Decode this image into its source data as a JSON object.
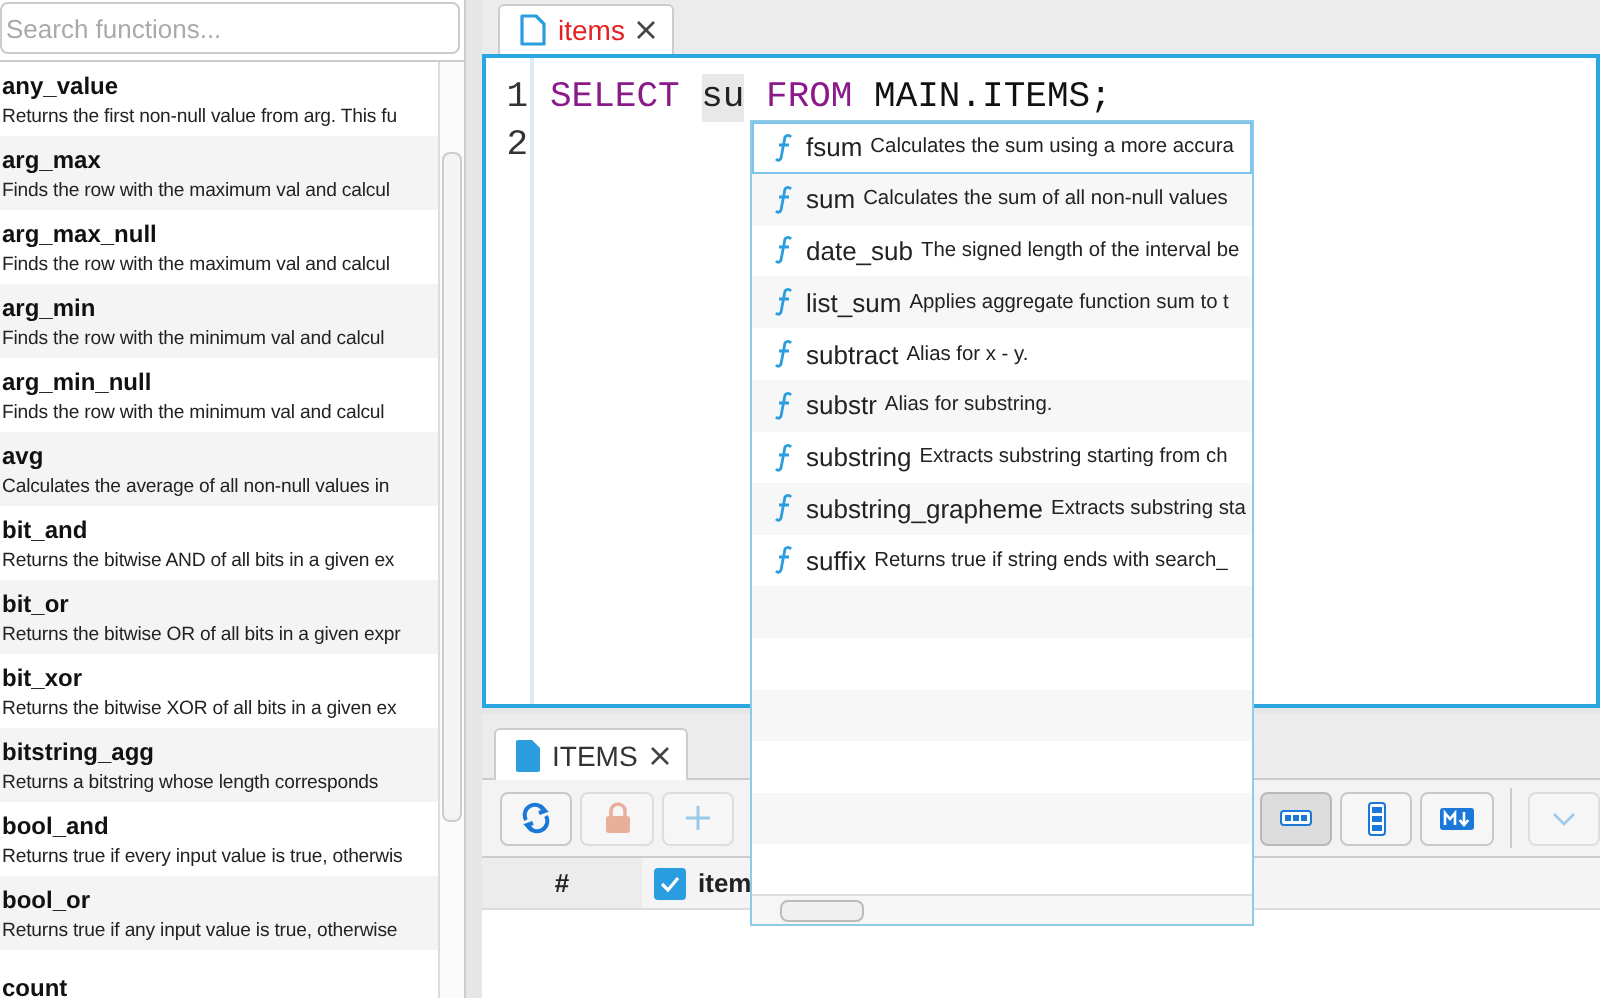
{
  "sidebar": {
    "search": {
      "placeholder": "Search functions..."
    },
    "functions": [
      {
        "name": "any_value",
        "description": "Returns the first non-null value from arg. This fu"
      },
      {
        "name": "arg_max",
        "description": "Finds the row with the maximum val and calcul"
      },
      {
        "name": "arg_max_null",
        "description": "Finds the row with the maximum val and calcul"
      },
      {
        "name": "arg_min",
        "description": "Finds the row with the minimum val and calcul"
      },
      {
        "name": "arg_min_null",
        "description": "Finds the row with the minimum val and calcul"
      },
      {
        "name": "avg",
        "description": "Calculates the average of all non-null values in"
      },
      {
        "name": "bit_and",
        "description": "Returns the bitwise AND of all bits in a given ex"
      },
      {
        "name": "bit_or",
        "description": "Returns the bitwise OR of all bits in a given expr"
      },
      {
        "name": "bit_xor",
        "description": "Returns the bitwise XOR of all bits in a given ex"
      },
      {
        "name": "bitstring_agg",
        "description": "Returns a bitstring whose length corresponds"
      },
      {
        "name": "bool_and",
        "description": "Returns true if every input value is true, otherwis"
      },
      {
        "name": "bool_or",
        "description": "Returns true if any input value is true, otherwise"
      },
      {
        "name": "count"
      }
    ]
  },
  "editor": {
    "tabs": [
      {
        "label": "items",
        "selected": true,
        "modified": true
      }
    ],
    "lines": [
      {
        "number": "1",
        "tokens": [
          {
            "text": "SELECT",
            "kind": "keyword"
          },
          {
            "text": "su",
            "kind": "current"
          },
          {
            "text": "FROM",
            "kind": "keyword"
          },
          {
            "text": "MAIN.ITEMS;",
            "kind": "plain"
          }
        ]
      },
      {
        "number": "2"
      }
    ],
    "completions": [
      {
        "name": "fsum",
        "description": "Calculates the sum using a more accura",
        "selected": true
      },
      {
        "name": "sum",
        "description": "Calculates the sum of all non-null values",
        "selected": false
      },
      {
        "name": "date_sub",
        "description": "The signed length of the interval be",
        "selected": false
      },
      {
        "name": "list_sum",
        "description": "Applies aggregate function sum to t",
        "selected": false
      },
      {
        "name": "subtract",
        "description": "Alias for x - y.",
        "selected": false
      },
      {
        "name": "substr",
        "description": "Alias for substring.",
        "selected": false
      },
      {
        "name": "substring",
        "description": "Extracts substring starting from ch",
        "selected": false
      },
      {
        "name": "substring_grapheme",
        "description": "Extracts substring sta",
        "selected": false
      },
      {
        "name": "suffix",
        "description": "Returns true if string ends with search_",
        "selected": false
      }
    ]
  },
  "results": {
    "tabs": [
      {
        "label": "ITEMS",
        "selected": true
      }
    ],
    "actions": [
      {
        "kind": "refresh",
        "disabled": false
      },
      {
        "kind": "lock",
        "disabled": true
      },
      {
        "kind": "add",
        "disabled": true
      }
    ],
    "views": [
      {
        "kind": "grid",
        "selected": true
      },
      {
        "kind": "rows",
        "selected": false
      },
      {
        "kind": "markdown",
        "selected": false
      }
    ],
    "menu": {
      "disabled": true
    },
    "columns": [
      {
        "label": "#",
        "kind": "index"
      },
      {
        "label": "item",
        "kind": "check",
        "checked": true
      }
    ]
  }
}
